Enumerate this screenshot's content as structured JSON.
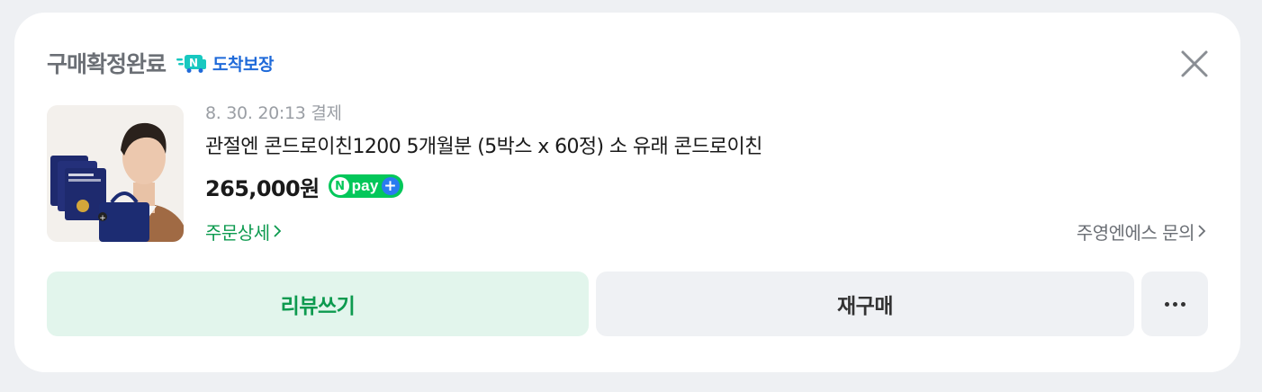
{
  "order": {
    "status": "구매확정완료",
    "badge_label": "도착보장",
    "date": "8. 30. 20:13 결제",
    "product_title": "관절엔 콘드로이친1200 5개월분 (5박스 x 60정) 소 유래 콘드로이친",
    "price": "265,000원",
    "npay": {
      "n": "N",
      "text": "pay",
      "plus": "+"
    },
    "order_detail_label": "주문상세",
    "seller_inquiry_label": "주영엔에스 문의"
  },
  "actions": {
    "review_label": "리뷰쓰기",
    "rebuy_label": "재구매"
  },
  "colors": {
    "green": "#0d9a4f",
    "npay_green": "#03c75a",
    "badge_blue": "#1f6ad9",
    "review_bg": "#e2f5ec"
  }
}
